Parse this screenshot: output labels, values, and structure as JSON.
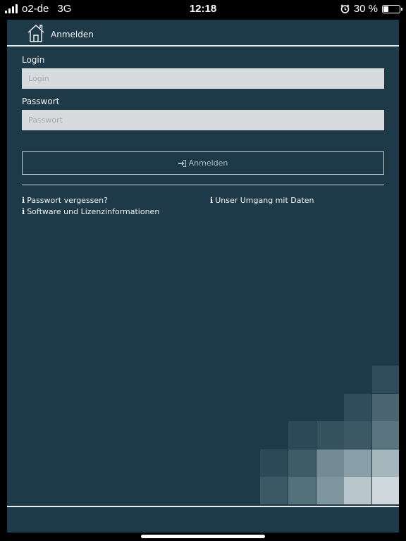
{
  "status_bar": {
    "carrier": "o2-de",
    "network": "3G",
    "time": "12:18",
    "battery": "30 %",
    "battery_level": 0.3
  },
  "navbar": {
    "title": "Anmelden",
    "icon": "home-icon"
  },
  "form": {
    "login_label": "Login",
    "login_placeholder": "Login",
    "login_value": "",
    "password_label": "Passwort",
    "password_placeholder": "Passwort",
    "password_value": "",
    "submit_label": "Anmelden",
    "submit_icon": "sign-in-icon"
  },
  "links": {
    "forgot_password": "Passwort vergessen?",
    "software_info": "Software und Lizenzinformationen",
    "data_policy": "Unser Umgang mit Daten",
    "icon": "info-icon"
  },
  "colors": {
    "background": "#1e3a48",
    "input_bg": "#d7dbdd",
    "text": "#f4f7f8"
  }
}
